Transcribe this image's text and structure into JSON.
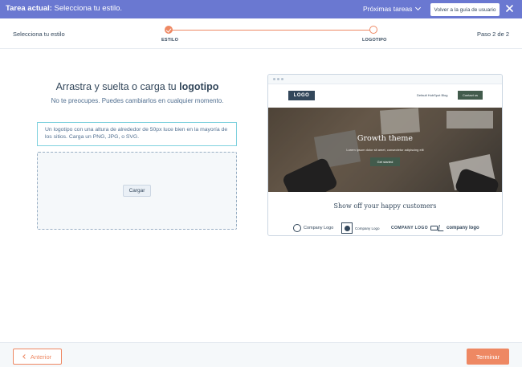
{
  "topbar": {
    "task_label": "Tarea actual:",
    "task_value": "Selecciona tu estilo.",
    "next_tasks": "Próximas tareas",
    "guide_button": "Volver a la guía de usuario"
  },
  "progress": {
    "left_text": "Selecciona tu estilo",
    "step_text": "Paso 2 de 2",
    "steps": [
      {
        "label": "ESTILO",
        "state": "done"
      },
      {
        "label": "LOGOTIPO",
        "state": "current"
      }
    ],
    "accent_color": "#ee8863"
  },
  "main": {
    "heading_prefix": "Arrastra y suelta o carga tu",
    "heading_bold": "logotipo",
    "subheading": "No te preocupes. Puedes cambiarlos en cualquier momento.",
    "info_text": "Un logotipo con una altura de alrededor de 50px luce bien en la mayoría de los sitios. Carga un PNG, JPG, o SVG.",
    "upload_button": "Cargar"
  },
  "preview": {
    "logo_text": "LOGO",
    "nav_link": "Default HubSpot Blog",
    "contact_button": "Contact us",
    "hero_title": "Growth theme",
    "hero_text": "Lorem ipsum dolor sit amet, consectetur adipiscing elit",
    "hero_cta": "Get started",
    "customers_heading": "Show off your happy customers",
    "customer_logos": [
      "Company Logo",
      "Company Logo",
      "COMPANY LOGO",
      "company logo"
    ]
  },
  "footer": {
    "prev_button": "Anterior",
    "finish_button": "Terminar"
  },
  "colors": {
    "topbar": "#6a78d1",
    "accent": "#ee8863",
    "info_border": "#7fd1de",
    "preview_green": "#425b4c"
  }
}
